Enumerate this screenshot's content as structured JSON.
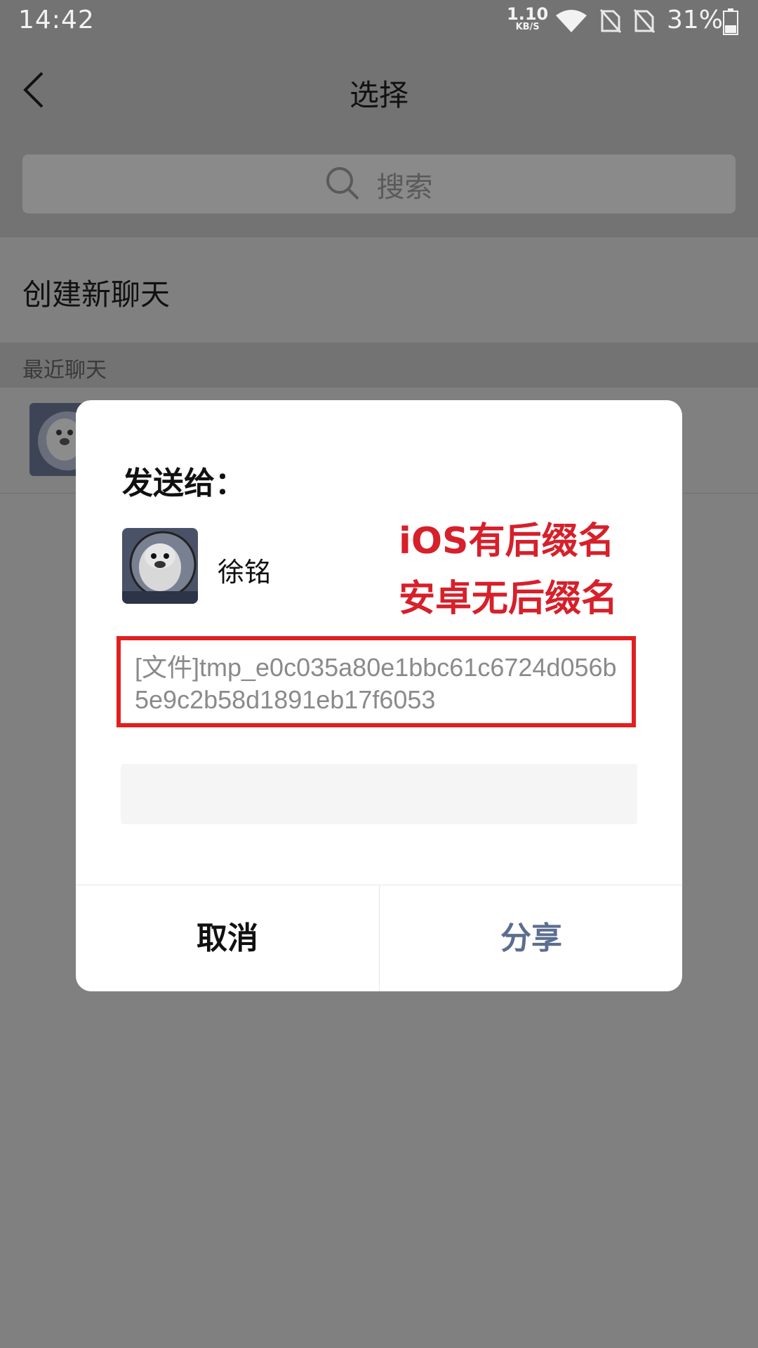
{
  "status_bar": {
    "time": "14:42",
    "net_speed_value": "1.10",
    "net_speed_unit": "KB/S",
    "battery_percent": "31%",
    "icons": [
      "wifi-icon",
      "no-sim-icon",
      "no-sim-icon",
      "battery-icon"
    ]
  },
  "header": {
    "title": "选择",
    "back_icon": "chevron-left-icon"
  },
  "search": {
    "placeholder": "搜索",
    "icon": "search-icon"
  },
  "new_chat": {
    "label": "创建新聊天"
  },
  "recent": {
    "header": "最近聊天"
  },
  "dialog": {
    "title": "发送给：",
    "recipient_name": "徐铭",
    "annotation_line1": "iOS有后缀名",
    "annotation_line2": "安卓无后缀名",
    "file_name": "[文件]tmp_e0c035a80e1bbc61c6724d056b5e9c2b58d1891eb17f6053",
    "message_placeholder": "",
    "cancel_label": "取消",
    "share_label": "分享",
    "colors": {
      "annotation": "#d6202a",
      "highlight_border": "#e02020",
      "share": "#5a6e90"
    }
  }
}
